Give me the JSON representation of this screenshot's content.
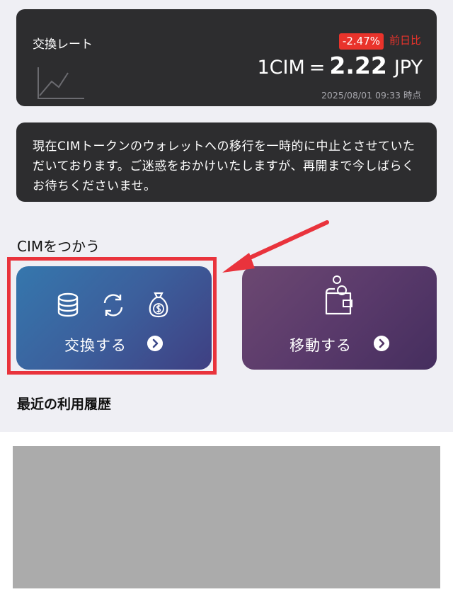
{
  "rate": {
    "label": "交換レート",
    "change_badge": "-2.47%",
    "change_label": "前日比",
    "unit": "1CIM",
    "equals": "=",
    "value": "2.22",
    "currency": "JPY",
    "timestamp": "2025/08/01 09:33 時点"
  },
  "notice": {
    "text": "現在CIMトークンのウォレットへの移行を一時的に中止とさせていただいております。ご迷惑をおかけいたしますが、再開まで今しばらくお待ちくださいませ。"
  },
  "use_section": {
    "title": "CIMをつかう",
    "exchange_label": "交換する",
    "move_label": "移動する"
  },
  "history_section": {
    "title": "最近の利用履歴"
  },
  "colors": {
    "badge_red": "#e9332b",
    "highlight_red": "#e9333c",
    "dark_card": "#2d2d2f"
  }
}
